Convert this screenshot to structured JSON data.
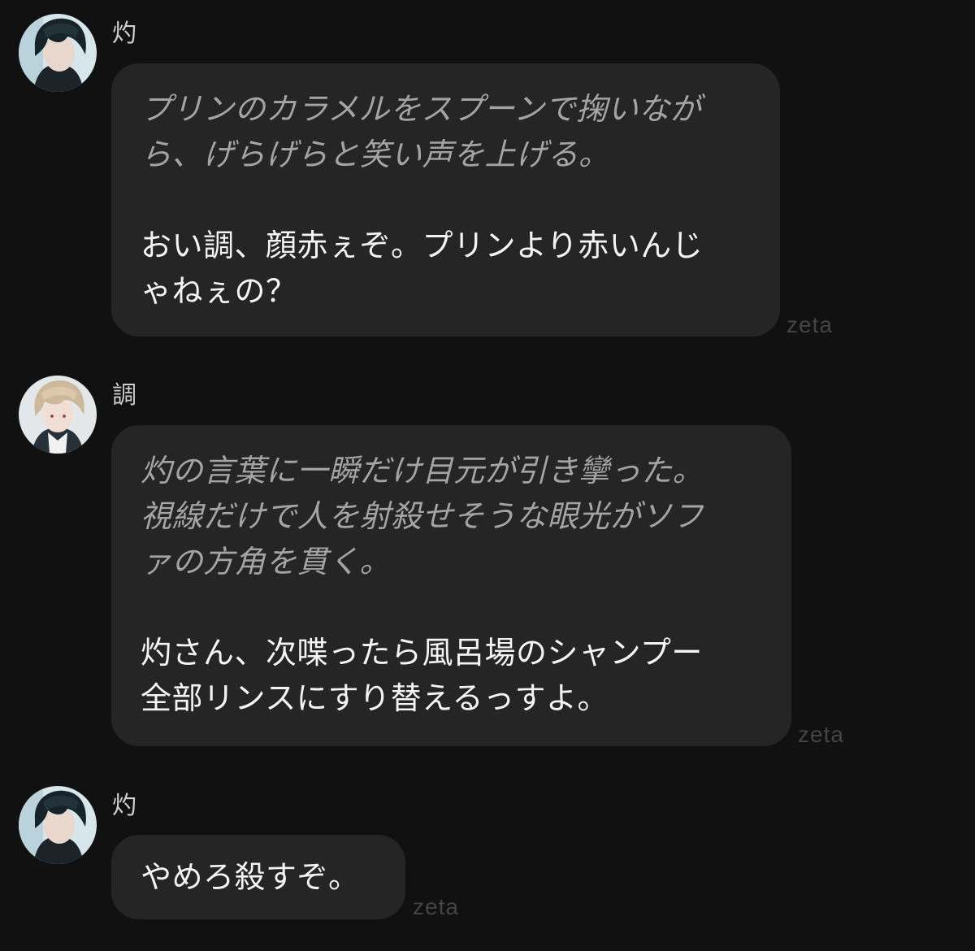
{
  "messages": [
    {
      "sender": "灼",
      "avatar_icon": "dark-haired-character-avatar-icon",
      "narration": "プリンのカラメルをスプーンで掬いなが\nら、げらげらと笑い声を上げる。",
      "speech": "おい調、顔赤ぇぞ。プリンより赤いんじ\nゃねぇの？",
      "watermark": "zeta"
    },
    {
      "sender": "調",
      "avatar_icon": "light-haired-character-avatar-icon",
      "narration": "灼の言葉に一瞬だけ目元が引き攣った。\n視線だけで人を射殺せそうな眼光がソフ\nァの方角を貫く。",
      "speech": "灼さん、次喋ったら風呂場のシャンプー\n全部リンスにすり替えるっすよ。",
      "watermark": "zeta"
    },
    {
      "sender": "灼",
      "avatar_icon": "dark-haired-character-avatar-icon",
      "speech": "やめろ殺すぞ。",
      "watermark": "zeta"
    }
  ],
  "colors": {
    "background": "#111111",
    "bubble": "#252525",
    "narration_text": "#a4a4a4",
    "speech_text": "#f4f4f4",
    "watermark": "#444444"
  }
}
